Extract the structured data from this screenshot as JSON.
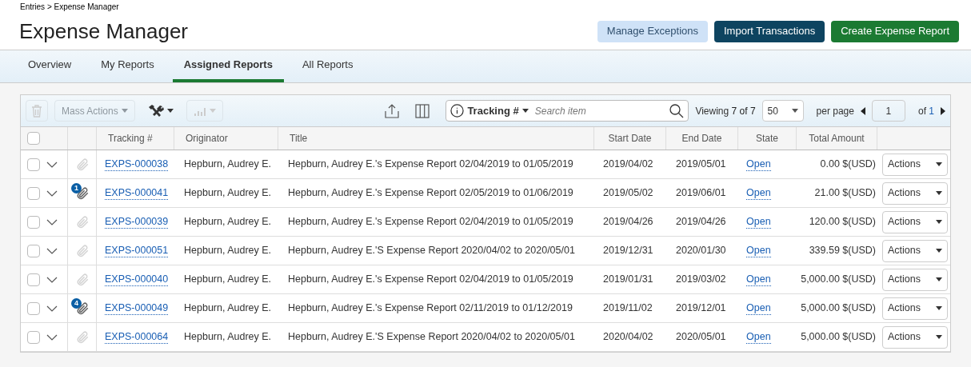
{
  "breadcrumb": "Entries > Expense Manager",
  "title": "Expense Manager",
  "header_buttons": [
    {
      "label": "Manage Exceptions",
      "kind": "light"
    },
    {
      "label": "Import Transactions",
      "kind": "dark"
    },
    {
      "label": "Create Expense Report",
      "kind": "green"
    }
  ],
  "tabs": [
    {
      "label": "Overview",
      "selected": false
    },
    {
      "label": "My Reports",
      "selected": false
    },
    {
      "label": "Assigned Reports",
      "selected": true
    },
    {
      "label": "All Reports",
      "selected": false
    }
  ],
  "toolbar": {
    "delete_disabled": true,
    "mass_actions": {
      "label": "Mass Actions",
      "disabled": true
    },
    "chart_disabled": true,
    "search": {
      "field": "Tracking #",
      "placeholder": "Search item"
    },
    "viewing_label": "Viewing",
    "viewing_count": "7 of 7",
    "per_page": "50",
    "per_page_label": "per page",
    "page": "1",
    "of_label": "of",
    "page_total": "1"
  },
  "table": {
    "select_all_checked": false,
    "columns": [
      "Tracking #",
      "Originator",
      "Title",
      "Start Date",
      "End Date",
      "State",
      "Total Amount"
    ],
    "rows": [
      {
        "checked": false,
        "tracking": "EXPS-000038",
        "originator": "Hepburn, Audrey E.",
        "title": "Hepburn, Audrey E.'s Expense Report 02/04/2019 to 01/05/2019",
        "start": "2019/04/02",
        "end": "2019/05/01",
        "state": "Open",
        "total": "0.00 $(USD)",
        "action": "Actions"
      },
      {
        "checked": false,
        "attachment_count": "1",
        "tracking": "EXPS-000041",
        "originator": "Hepburn, Audrey E.",
        "title": "Hepburn, Audrey E.'s Expense Report 02/05/2019 to 01/06/2019",
        "start": "2019/05/02",
        "end": "2019/06/01",
        "state": "Open",
        "total": "21.00 $(USD)",
        "action": "Actions"
      },
      {
        "checked": false,
        "tracking": "EXPS-000039",
        "originator": "Hepburn, Audrey E.",
        "title": "Hepburn, Audrey E.'s Expense Report 02/04/2019 to 01/05/2019",
        "start": "2019/04/26",
        "end": "2019/04/26",
        "state": "Open",
        "total": "120.00 $(USD)",
        "action": "Actions"
      },
      {
        "checked": false,
        "tracking": "EXPS-000051",
        "originator": "Hepburn, Audrey E.",
        "title": "Hepburn, Audrey E.'S Expense Report 2020/04/02 to 2020/05/01",
        "start": "2019/12/31",
        "end": "2020/01/30",
        "state": "Open",
        "total": "339.59 $(USD)",
        "action": "Actions"
      },
      {
        "checked": false,
        "tracking": "EXPS-000040",
        "originator": "Hepburn, Audrey E.",
        "title": "Hepburn, Audrey E.'s Expense Report 02/04/2019 to 01/05/2019",
        "start": "2019/01/31",
        "end": "2019/03/02",
        "state": "Open",
        "total": "5,000.00 $(USD)",
        "action": "Actions"
      },
      {
        "checked": false,
        "attachment_count": "4",
        "tracking": "EXPS-000049",
        "originator": "Hepburn, Audrey E.",
        "title": "Hepburn, Audrey E.'s Expense Report 02/11/2019 to 01/12/2019",
        "start": "2019/11/02",
        "end": "2019/12/01",
        "state": "Open",
        "total": "5,000.00 $(USD)",
        "action": "Actions"
      },
      {
        "checked": false,
        "tracking": "EXPS-000064",
        "originator": "Hepburn, Audrey E.",
        "title": "Hepburn, Audrey E.'S Expense Report 2020/04/02 to 2020/05/01",
        "start": "2020/04/02",
        "end": "2020/05/01",
        "state": "Open",
        "total": "5,000.00 $(USD)",
        "action": "Actions"
      }
    ]
  }
}
